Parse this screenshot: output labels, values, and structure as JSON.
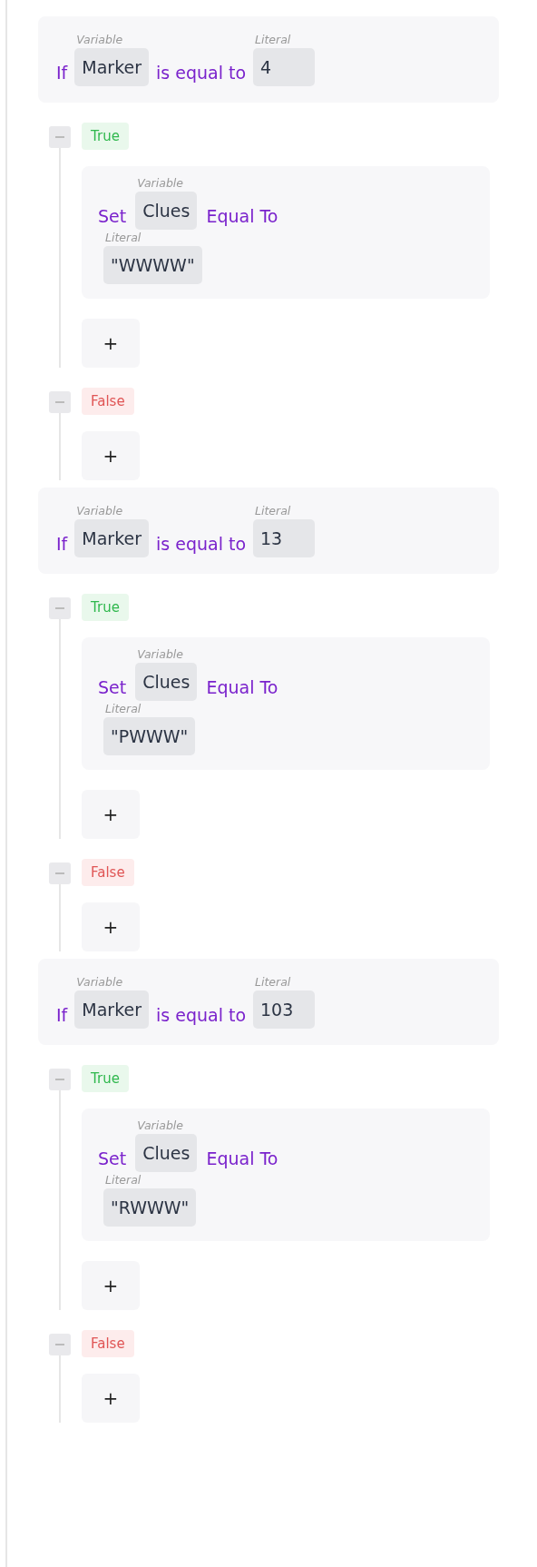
{
  "blocks": [
    {
      "condition": {
        "keyword": "If",
        "subject": {
          "tag": "Variable",
          "value": "Marker"
        },
        "operator": "is equal to",
        "object": {
          "tag": "Literal",
          "value": "4"
        }
      },
      "branches": [
        {
          "kind": "true",
          "label": "True",
          "statements": [
            {
              "keyword": "Set",
              "target": {
                "tag": "Variable",
                "value": "Clues"
              },
              "operator": "Equal To",
              "value": {
                "tag": "Literal",
                "value": "\"WWWW\""
              }
            }
          ],
          "add": "+"
        },
        {
          "kind": "false",
          "label": "False",
          "add": "+"
        }
      ]
    },
    {
      "condition": {
        "keyword": "If",
        "subject": {
          "tag": "Variable",
          "value": "Marker"
        },
        "operator": "is equal to",
        "object": {
          "tag": "Literal",
          "value": "13"
        }
      },
      "branches": [
        {
          "kind": "true",
          "label": "True",
          "statements": [
            {
              "keyword": "Set",
              "target": {
                "tag": "Variable",
                "value": "Clues"
              },
              "operator": "Equal To",
              "value": {
                "tag": "Literal",
                "value": "\"PWWW\""
              }
            }
          ],
          "add": "+"
        },
        {
          "kind": "false",
          "label": "False",
          "add": "+"
        }
      ]
    },
    {
      "condition": {
        "keyword": "If",
        "subject": {
          "tag": "Variable",
          "value": "Marker"
        },
        "operator": "is equal to",
        "object": {
          "tag": "Literal",
          "value": "103"
        }
      },
      "branches": [
        {
          "kind": "true",
          "label": "True",
          "statements": [
            {
              "keyword": "Set",
              "target": {
                "tag": "Variable",
                "value": "Clues"
              },
              "operator": "Equal To",
              "value": {
                "tag": "Literal",
                "value": "\"RWWW\""
              }
            }
          ],
          "add": "+"
        },
        {
          "kind": "false",
          "label": "False",
          "add": "+"
        }
      ]
    }
  ]
}
